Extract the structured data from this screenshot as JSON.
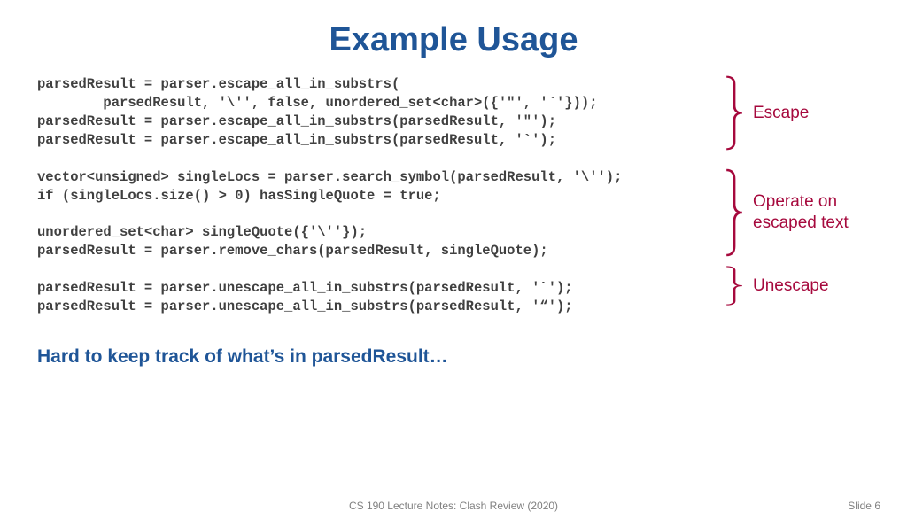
{
  "title": "Example Usage",
  "code": "parsedResult = parser.escape_all_in_substrs(\n        parsedResult, '\\'', false, unordered_set<char>({'\"', '`'}));\nparsedResult = parser.escape_all_in_substrs(parsedResult, '\"');\nparsedResult = parser.escape_all_in_substrs(parsedResult, '`');\n\nvector<unsigned> singleLocs = parser.search_symbol(parsedResult, '\\'');\nif (singleLocs.size() > 0) hasSingleQuote = true;\n\nunordered_set<char> singleQuote({'\\''});\nparsedResult = parser.remove_chars(parsedResult, singleQuote);\n\nparsedResult = parser.unescape_all_in_substrs(parsedResult, '`');\nparsedResult = parser.unescape_all_in_substrs(parsedResult, '“');",
  "annotations": {
    "escape": "Escape",
    "operate": "Operate on\nescaped text",
    "unescape": "Unescape"
  },
  "caption": "Hard to keep track of what’s in parsedResult…",
  "footer": {
    "center": "CS 190 Lecture Notes: Clash Review (2020)",
    "right": "Slide 6"
  },
  "colors": {
    "heading": "#1f5597",
    "annotation": "#a6093d",
    "code": "#404040",
    "footer": "#808080"
  }
}
